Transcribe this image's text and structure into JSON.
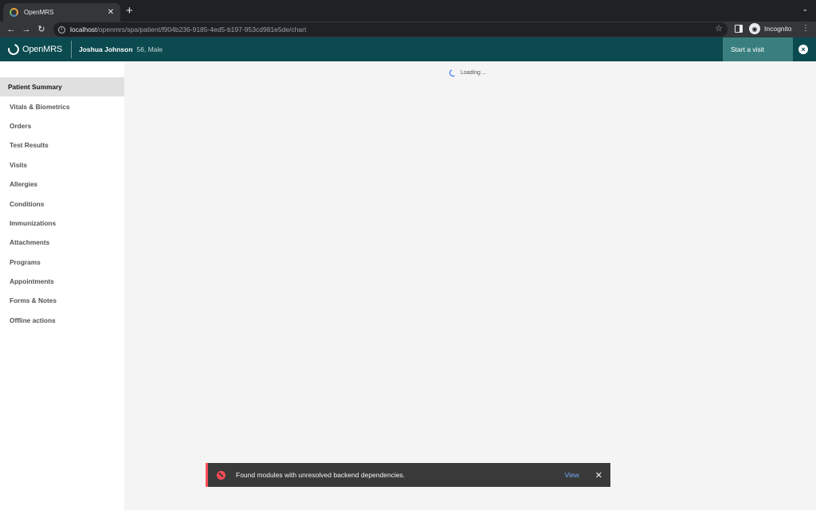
{
  "browser": {
    "tab_title": "OpenMRS",
    "tab_close": "✕",
    "new_tab": "+",
    "tabstrip_menu": "⌄",
    "back": "←",
    "forward": "→",
    "reload": "↻",
    "url_host": "localhost",
    "url_path": "/openmrs/spa/patient/f904b236-9185-4ed5-b197-953cd981e5de/chart",
    "bookmark": "☆",
    "profile_label": "Incognito",
    "menu": "⋮"
  },
  "header": {
    "logo_text": "OpenMRS",
    "patient_name": "Joshua Johnson",
    "patient_meta": "56, Male",
    "start_visit_label": "Start a visit",
    "close_label": "×",
    "brand_color": "#0b4a4f"
  },
  "sidebar": {
    "items": [
      {
        "label": "Patient Summary",
        "active": true
      },
      {
        "label": "Vitals & Biometrics"
      },
      {
        "label": "Orders"
      },
      {
        "label": "Test Results"
      },
      {
        "label": "Visits"
      },
      {
        "label": "Allergies"
      },
      {
        "label": "Conditions"
      },
      {
        "label": "Immunizations"
      },
      {
        "label": "Attachments"
      },
      {
        "label": "Programs"
      },
      {
        "label": "Appointments"
      },
      {
        "label": "Forms & Notes"
      },
      {
        "label": "Offline actions"
      }
    ]
  },
  "main": {
    "loading_text": "Loading ..."
  },
  "toast": {
    "message": "Found modules with unresolved backend dependencies.",
    "action_label": "View",
    "close_label": "✕",
    "status_color": "#fa4d56"
  }
}
